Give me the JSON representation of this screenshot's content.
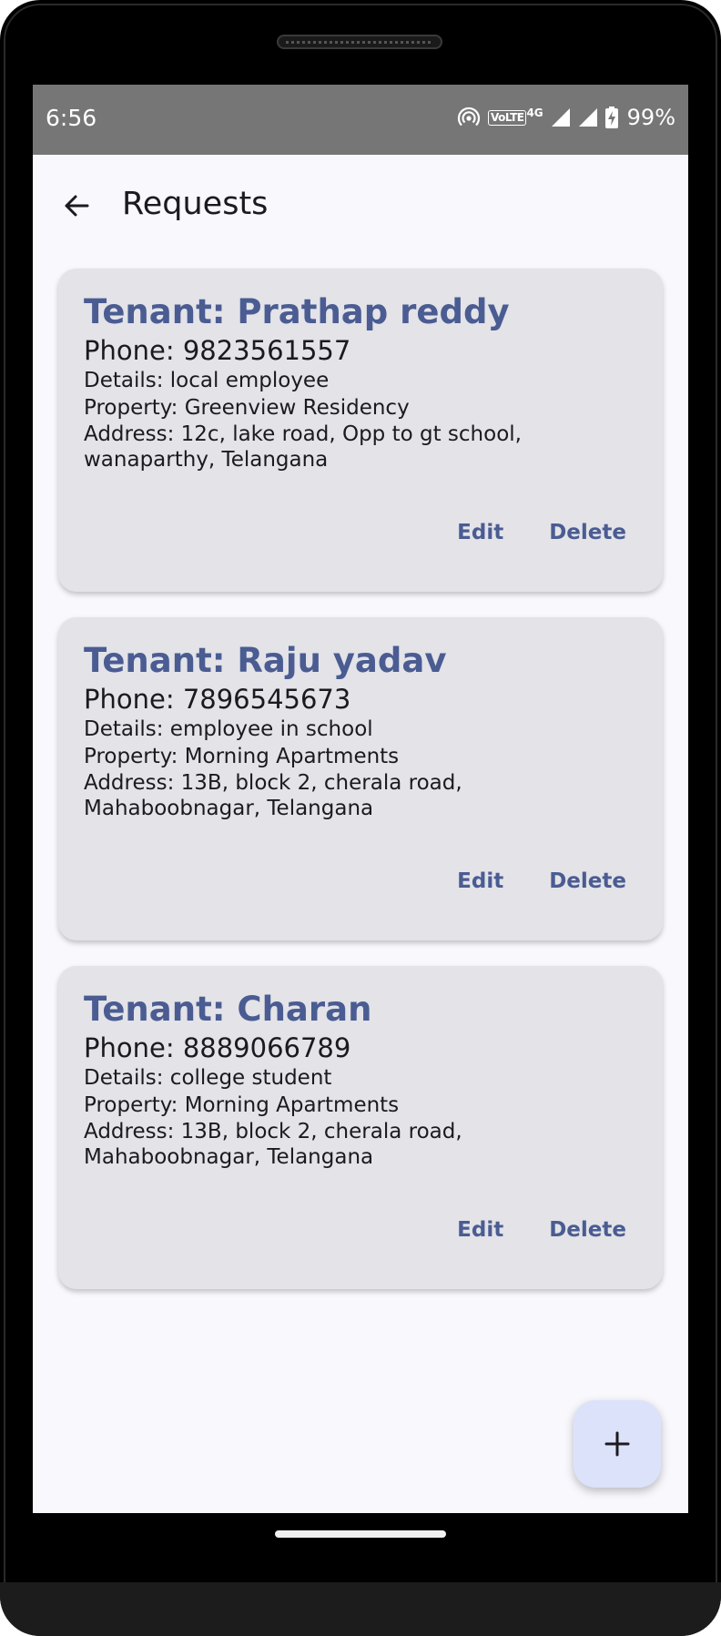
{
  "status_bar": {
    "time": "6:56",
    "network": "4G",
    "volte": "VoLTE",
    "battery_percent": "99%"
  },
  "app_bar": {
    "title": "Requests",
    "back_icon": "arrow-back-icon"
  },
  "requests": [
    {
      "tenant": "Tenant: Prathap reddy",
      "phone": "Phone: 9823561557",
      "details": "Details: local employee",
      "property": "Property: Greenview Residency",
      "address": "Address: 12c, lake road, Opp to gt school, wanaparthy, Telangana",
      "edit_label": "Edit",
      "delete_label": "Delete"
    },
    {
      "tenant": "Tenant: Raju yadav",
      "phone": "Phone: 7896545673",
      "details": "Details: employee in school",
      "property": "Property: Morning Apartments",
      "address": "Address: 13B, block 2, cherala road, Mahaboobnagar, Telangana",
      "edit_label": "Edit",
      "delete_label": "Delete"
    },
    {
      "tenant": "Tenant: Charan",
      "phone": "Phone: 8889066789",
      "details": "Details: college student",
      "property": "Property: Morning Apartments",
      "address": "Address: 13B, block 2, cherala road, Mahaboobnagar, Telangana",
      "edit_label": "Edit",
      "delete_label": "Delete"
    }
  ],
  "fab": {
    "icon": "add-icon"
  },
  "colors": {
    "accent": "#4a5c92",
    "card_bg": "#e3e3e8",
    "screen_bg": "#f8f8fd",
    "fab_bg": "#dde2fb",
    "status_bar_bg": "#767676"
  }
}
